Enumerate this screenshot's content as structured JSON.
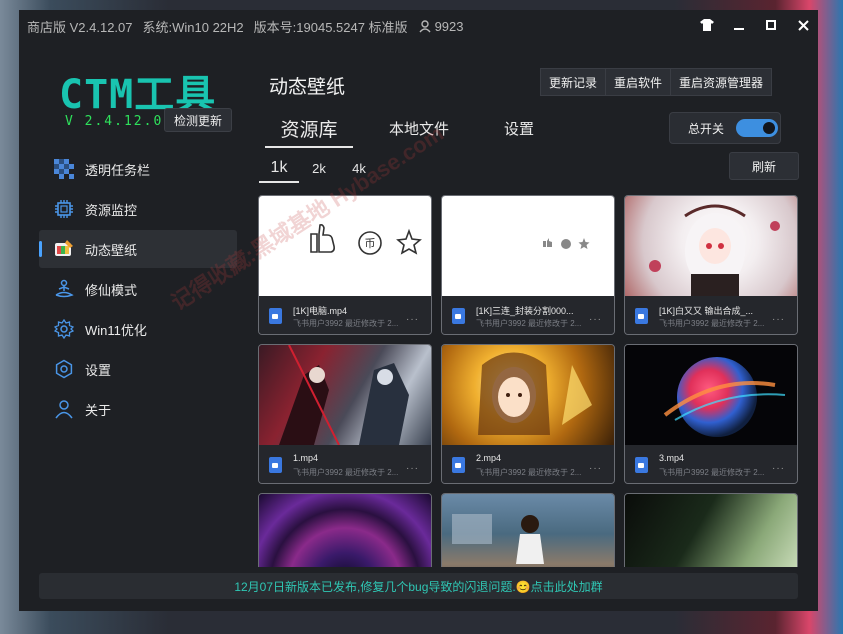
{
  "titlebar": {
    "version": "商店版 V2.4.12.07",
    "system": "系统:Win10 22H2",
    "build": "版本号:19045.5247 标准版",
    "user_count": "9923"
  },
  "app": {
    "logo": "CTM工具",
    "version": "V 2.4.12.07",
    "check_update": "检测更新"
  },
  "sidebar": {
    "items": [
      {
        "label": "透明任务栏",
        "icon": "checker-icon"
      },
      {
        "label": "资源监控",
        "icon": "chip-icon"
      },
      {
        "label": "动态壁纸",
        "icon": "paint-icon"
      },
      {
        "label": "修仙模式",
        "icon": "meditation-icon"
      },
      {
        "label": "Win11优化",
        "icon": "gear-icon"
      },
      {
        "label": "设置",
        "icon": "settings-icon"
      },
      {
        "label": "关于",
        "icon": "person-icon"
      }
    ]
  },
  "header": {
    "title": "动态壁纸",
    "buttons": [
      "更新记录",
      "重启软件",
      "重启资源管理器"
    ]
  },
  "tabs": [
    "资源库",
    "本地文件",
    "设置"
  ],
  "master_switch": {
    "label": "总开关",
    "on": true
  },
  "res_tabs": [
    "1k",
    "2k",
    "4k"
  ],
  "refresh_label": "刷新",
  "cards": [
    {
      "name": "[1K]电脑.mp4",
      "sub": "飞书用户3992 最近修改于 2..."
    },
    {
      "name": "[1K]三连_封装分割000...",
      "sub": "飞书用户3992 最近修改于 2..."
    },
    {
      "name": "[1K]白又又 输出合成_...",
      "sub": "飞书用户3992 最近修改于 2..."
    },
    {
      "name": "1.mp4",
      "sub": "飞书用户3992 最近修改于 2..."
    },
    {
      "name": "2.mp4",
      "sub": "飞书用户3992 最近修改于 2..."
    },
    {
      "name": "3.mp4",
      "sub": "飞书用户3992 最近修改于 2..."
    },
    {
      "name": "",
      "sub": ""
    },
    {
      "name": "",
      "sub": ""
    },
    {
      "name": "",
      "sub": ""
    }
  ],
  "banner": "12月07日新版本已发布,修复几个bug导致的闪退问题.😊点击此处加群",
  "watermark": "记得收藏:黑域基地 Hybase.com",
  "colors": {
    "accent": "#19c4b0",
    "version_green": "#2ee05b",
    "switch_blue": "#3d8fe0",
    "window_bg": "#1e2024"
  }
}
